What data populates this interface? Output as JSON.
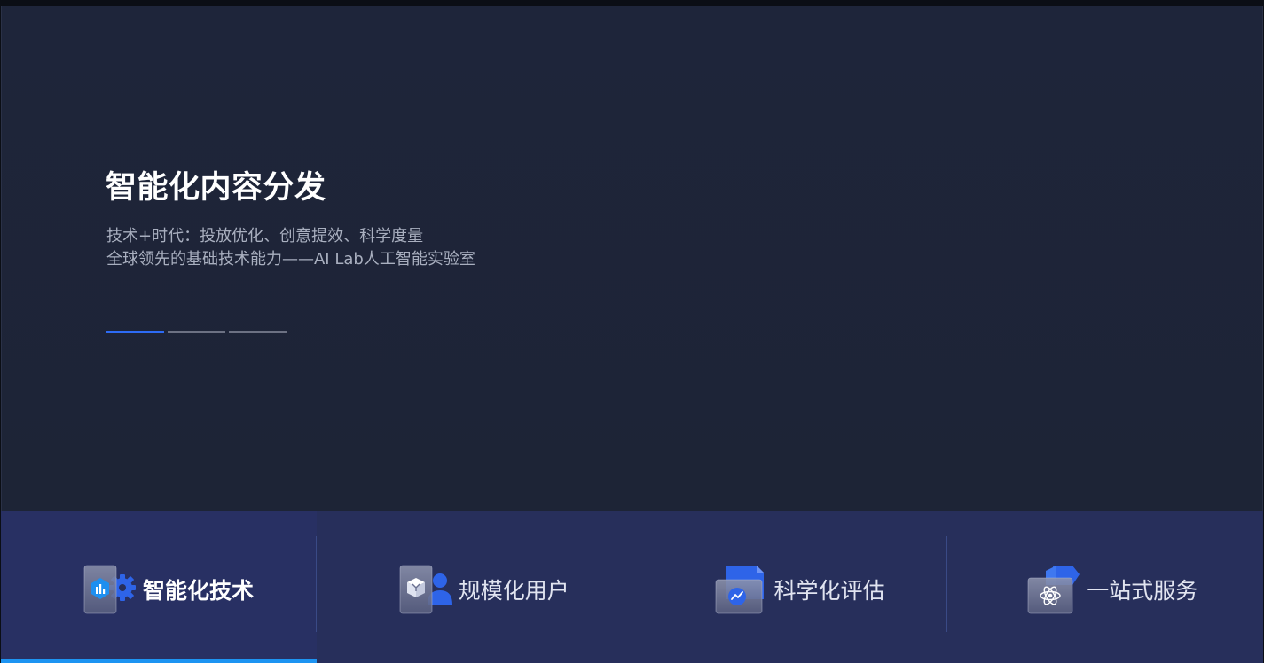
{
  "hero": {
    "title": "智能化内容分发",
    "subtitle_line1": "技术+时代：投放优化、创意提效、科学度量",
    "subtitle_line2": "全球领先的基础技术能力——AI Lab人工智能实验室",
    "slides_total": 3,
    "active_slide": 1
  },
  "tabs": [
    {
      "label": "智能化技术",
      "icon": "ai-chart-gear-icon",
      "active": true
    },
    {
      "label": "规模化用户",
      "icon": "users-cube-icon",
      "active": false
    },
    {
      "label": "科学化评估",
      "icon": "analytics-document-icon",
      "active": false
    },
    {
      "label": "一站式服务",
      "icon": "atom-service-icon",
      "active": false
    }
  ],
  "colors": {
    "hero_bg": "#1e253a",
    "tabbar_bg": "#272f5b",
    "accent_blue": "#2d6bf5",
    "active_underline": "#1d94f2",
    "indicator_inactive": "#6c7183"
  }
}
